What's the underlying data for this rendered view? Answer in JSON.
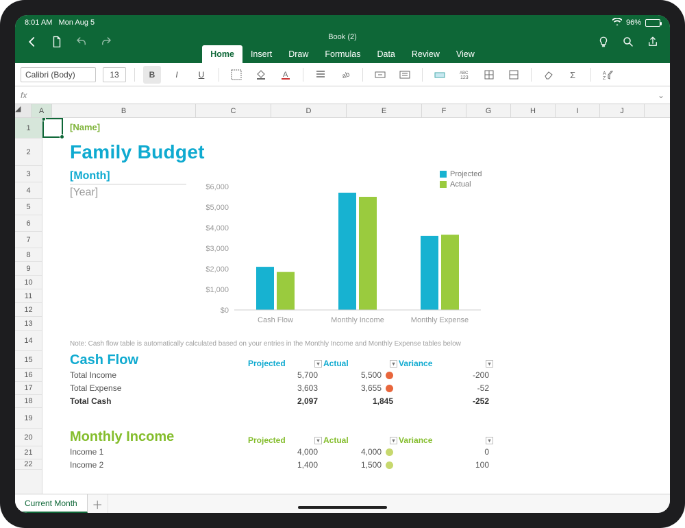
{
  "status": {
    "time": "8:01 AM",
    "date": "Mon Aug 5",
    "battery": "96%"
  },
  "app": {
    "title": "Book (2)",
    "tabs": [
      "Home",
      "Insert",
      "Draw",
      "Formulas",
      "Data",
      "Review",
      "View"
    ],
    "active_tab": "Home"
  },
  "toolbar": {
    "font_name": "Calibri (Body)",
    "font_size": "13"
  },
  "formula_bar": {
    "label": "fx"
  },
  "columns": [
    "A",
    "B",
    "C",
    "D",
    "E",
    "F",
    "G",
    "H",
    "I",
    "J"
  ],
  "rows": [
    1,
    2,
    3,
    4,
    5,
    6,
    7,
    8,
    9,
    10,
    11,
    12,
    13,
    14,
    15,
    16,
    17,
    18,
    19,
    20,
    21,
    22
  ],
  "content": {
    "name": "[Name]",
    "title": "Family Budget",
    "month": "[Month]",
    "year": "[Year]",
    "note": "Note: Cash flow table is automatically calculated based on your entries in the Monthly Income and Monthly Expense tables below",
    "cashflow": {
      "title": "Cash Flow",
      "headers": [
        "Projected",
        "Actual",
        "Variance"
      ],
      "rows": [
        {
          "label": "Total Income",
          "projected": "5,700",
          "actual": "5,500",
          "variance": "-200",
          "dot": "red"
        },
        {
          "label": "Total Expense",
          "projected": "3,603",
          "actual": "3,655",
          "variance": "-52",
          "dot": "red"
        },
        {
          "label": "Total Cash",
          "projected": "2,097",
          "actual": "1,845",
          "variance": "-252",
          "bold": true
        }
      ]
    },
    "income": {
      "title": "Monthly Income",
      "headers": [
        "Projected",
        "Actual",
        "Variance"
      ],
      "rows": [
        {
          "label": "Income 1",
          "projected": "4,000",
          "actual": "4,000",
          "variance": "0",
          "dot": "grn"
        },
        {
          "label": "Income 2",
          "projected": "1,400",
          "actual": "1,500",
          "variance": "100",
          "dot": "grn"
        }
      ]
    }
  },
  "sheet_tab": "Current Month",
  "legend": {
    "projected": "Projected",
    "actual": "Actual"
  },
  "chart_data": {
    "type": "bar",
    "categories": [
      "Cash Flow",
      "Monthly Income",
      "Monthly Expense"
    ],
    "series": [
      {
        "name": "Projected",
        "values": [
          2097,
          5700,
          3603
        ],
        "color": "#17b2d1"
      },
      {
        "name": "Actual",
        "values": [
          1845,
          5500,
          3655
        ],
        "color": "#9acb3e"
      }
    ],
    "ylim": [
      0,
      6000
    ],
    "yticks": [
      0,
      1000,
      2000,
      3000,
      4000,
      5000,
      6000
    ],
    "ytick_labels": [
      "$0",
      "$1,000",
      "$2,000",
      "$3,000",
      "$4,000",
      "$5,000",
      "$6,000"
    ]
  }
}
